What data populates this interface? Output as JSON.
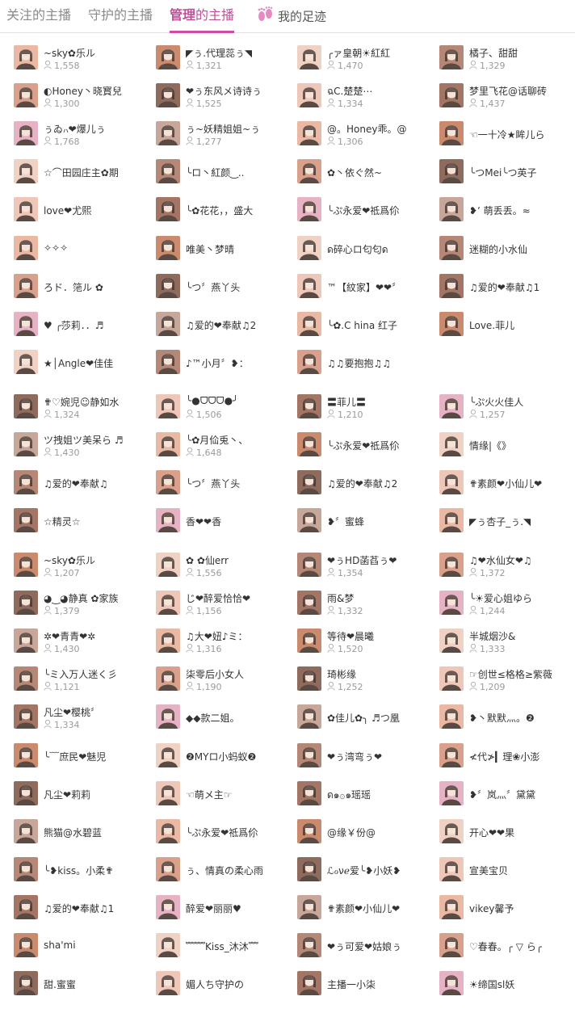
{
  "tabs": [
    {
      "label": "关注的主播"
    },
    {
      "label": "守护的主播"
    },
    {
      "label_strong": "管理",
      "label_rest": "的主播"
    },
    {
      "label": "我的足迹",
      "icon": "footprints-icon"
    }
  ],
  "colors": {
    "accent": "#d34aa3",
    "active_text": "#c24e9a",
    "muted": "#9a9a9a"
  },
  "sections": [
    {
      "rows": [
        [
          {
            "name": "~sky✿乐ル",
            "fans": "1,558"
          },
          {
            "name": "◤ぅ.代理蕊ぅ◥",
            "fans": "1,321"
          },
          {
            "name": "╭ァ皇朝☀紅紅",
            "fans": "1,470"
          },
          {
            "name": "橘子、甜甜",
            "fans": "1,329"
          }
        ],
        [
          {
            "name": "◐Honey丶晓寳兒",
            "fans": "1,300"
          },
          {
            "name": "❤ぅ东风メ诗诗ぅ",
            "fans": "1,525"
          },
          {
            "name": "ฉC.楚楚⋯",
            "fans": "1,334"
          },
          {
            "name": "梦里飞花@话聊砖",
            "fans": "1,437"
          }
        ],
        [
          {
            "name": "ぅゐ៸៶❤爆儿ぅ",
            "fans": "1,768"
          },
          {
            "name": "ぅ~妖精姐姐~ぅ",
            "fans": "1,277"
          },
          {
            "name": "@。Honey乖。@",
            "fans": "1,306"
          },
          {
            "name": "☜一十冷★眸儿ら",
            "fans": ""
          }
        ],
        [
          {
            "name": "☆⌒田园庄主✿期",
            "fans": ""
          },
          {
            "name": "╰ロ丶紅颜‿..",
            "fans": ""
          },
          {
            "name": "✿丶依ぐ然~",
            "fans": ""
          },
          {
            "name": "╰つMei╰つ英子",
            "fans": ""
          }
        ],
        [
          {
            "name": "love❤尤熙",
            "fans": ""
          },
          {
            "name": "╰✿花花，，盛大",
            "fans": ""
          },
          {
            "name": "╰ぷ永爱❤祗爲伱",
            "fans": ""
          },
          {
            "name": "❥ʼ 萌丢丢。≈",
            "fans": ""
          }
        ],
        [
          {
            "name": "✧✧✧",
            "fans": ""
          },
          {
            "name": "唯美丶梦晴",
            "fans": ""
          },
          {
            "name": "ด碎心ロ匂匂ด",
            "fans": ""
          },
          {
            "name": "迷糊的小水仙",
            "fans": ""
          }
        ],
        [
          {
            "name": "ろド．筂ル ✿",
            "fans": ""
          },
          {
            "name": "╰つ〞燕丫头",
            "fans": ""
          },
          {
            "name": "™【紋家】❤❤〞",
            "fans": ""
          },
          {
            "name": "♫爱的❤奉献♫1",
            "fans": ""
          }
        ],
        [
          {
            "name": "♥ ╭莎莉．．♬",
            "fans": ""
          },
          {
            "name": "♫爱的❤奉献♫2",
            "fans": ""
          },
          {
            "name": "╰✿.C hina 红子",
            "fans": ""
          },
          {
            "name": "Love.菲儿",
            "fans": ""
          }
        ],
        [
          {
            "name": "★│Angle❤佳佳",
            "fans": ""
          },
          {
            "name": "♪™小月〞❥：",
            "fans": ""
          },
          {
            "name": "♫♫要抱抱♫♫",
            "fans": ""
          }
        ]
      ]
    },
    {
      "rows": [
        [
          {
            "name": "✟♡婉児☺静如水",
            "fans": "1,324"
          },
          {
            "name": "╰●ᗜᗜᗜ●╯",
            "fans": "1,506"
          },
          {
            "name": "〓菲儿〓",
            "fans": "1,210"
          },
          {
            "name": "╰ぷ火火佳人",
            "fans": "1,257"
          }
        ],
        [
          {
            "name": "ツ拽姐ツ美呆ら ♬",
            "fans": "1,430"
          },
          {
            "name": "╰✿月佡兎丶、",
            "fans": "1,648"
          },
          {
            "name": "╰ぷ永爱❤祗爲伱",
            "fans": ""
          },
          {
            "name": "情缘|《》",
            "fans": ""
          }
        ],
        [
          {
            "name": "♫爱的❤奉献♫",
            "fans": ""
          },
          {
            "name": "╰つ〞燕丫头",
            "fans": ""
          },
          {
            "name": "♫爱的❤奉献♫2",
            "fans": ""
          },
          {
            "name": "✟素颜❤小仙儿❤",
            "fans": ""
          }
        ],
        [
          {
            "name": "☆精灵☆",
            "fans": ""
          },
          {
            "name": "香❤❤香",
            "fans": ""
          },
          {
            "name": "❥〞蜜蜂",
            "fans": ""
          },
          {
            "name": "◤ぅ杏子_ぅ.◥",
            "fans": ""
          }
        ]
      ]
    },
    {
      "rows": [
        [
          {
            "name": "~sky✿乐ル",
            "fans": "1,207"
          },
          {
            "name": "✿ ✿仙err",
            "fans": "1,556"
          },
          {
            "name": "❤ぅHD菡萏ぅ❤",
            "fans": "1,354"
          },
          {
            "name": "♫❤水仙女❤♫",
            "fans": "1,372"
          }
        ],
        [
          {
            "name": "◕‿◕静真 ✿家族",
            "fans": "1,379"
          },
          {
            "name": "じ❤醉爱恰恰❤",
            "fans": "1,156"
          },
          {
            "name": "雨&梦",
            "fans": "1,332"
          },
          {
            "name": "╰☀爱心姐ゆら",
            "fans": "1,244"
          }
        ],
        [
          {
            "name": "✲❤青青❤✲",
            "fans": "1,430"
          },
          {
            "name": "♫大❤妞♪ミ：",
            "fans": "1,316"
          },
          {
            "name": "等待❤晨曦",
            "fans": "1,520"
          },
          {
            "name": "半城烟沙&",
            "fans": "1,333"
          }
        ],
        [
          {
            "name": "╰ミ入万人迷く彡",
            "fans": "1,121"
          },
          {
            "name": "柒零后小女人",
            "fans": "1,190"
          },
          {
            "name": "琦彬缘",
            "fans": "1,252"
          },
          {
            "name": "☞创世≤格格≥紫薇",
            "fans": "1,209"
          }
        ],
        [
          {
            "name": "凡尘❤樱桃〞",
            "fans": "1,334"
          },
          {
            "name": "◆◆款二姐。",
            "fans": ""
          },
          {
            "name": "✿佳儿✿╮ ♬つ凰",
            "fans": ""
          },
          {
            "name": "❥丶默默灬。❷",
            "fans": ""
          }
        ],
        [
          {
            "name": "╰﹋庶民❤魅児",
            "fans": ""
          },
          {
            "name": "❷MYロ小蚂蚁❷",
            "fans": ""
          },
          {
            "name": "❤ぅ湾弯ぅ❤",
            "fans": ""
          },
          {
            "name": "≮代≯▎理❀小澎",
            "fans": ""
          }
        ],
        [
          {
            "name": "凡尘❤莉莉",
            "fans": ""
          },
          {
            "name": "☜萌メ主☞",
            "fans": ""
          },
          {
            "name": "ด๑۞๑瑶瑶",
            "fans": ""
          },
          {
            "name": "❥〞岚灬〞黛黛",
            "fans": ""
          }
        ],
        [
          {
            "name": "熊猫@水碧蓝",
            "fans": ""
          },
          {
            "name": "╰ぷ永爱❤祗爲伱",
            "fans": ""
          },
          {
            "name": "@缘￥份@",
            "fans": ""
          },
          {
            "name": "开心❤❤果",
            "fans": ""
          }
        ],
        [
          {
            "name": "╰❥kiss。小柔✟",
            "fans": ""
          },
          {
            "name": "ぅ、情真の柔心雨",
            "fans": ""
          },
          {
            "name": "ℒℴνℯ爱╰❥小妖❥",
            "fans": ""
          },
          {
            "name": "宣美宝贝",
            "fans": ""
          }
        ],
        [
          {
            "name": "♫爱的❤奉献♫1",
            "fans": ""
          },
          {
            "name": "醉爱❤丽丽♥",
            "fans": ""
          },
          {
            "name": "✟素颜❤小仙儿❤",
            "fans": ""
          },
          {
            "name": "vikey馨予",
            "fans": ""
          }
        ],
        [
          {
            "name": "sha'mi",
            "fans": ""
          },
          {
            "name": "﹌﹌Kiss_沐沐﹌",
            "fans": ""
          },
          {
            "name": "❤ぅ可爱❤姑娘ぅ",
            "fans": ""
          },
          {
            "name": "♡春春。╭ ▽ ら╭",
            "fans": ""
          }
        ],
        [
          {
            "name": "甜.蜜蜜",
            "fans": ""
          },
          {
            "name": "媚人ち守护の",
            "fans": ""
          },
          {
            "name": "主播一小柒",
            "fans": ""
          },
          {
            "name": "☀缔国sl妖",
            "fans": ""
          }
        ]
      ]
    }
  ]
}
